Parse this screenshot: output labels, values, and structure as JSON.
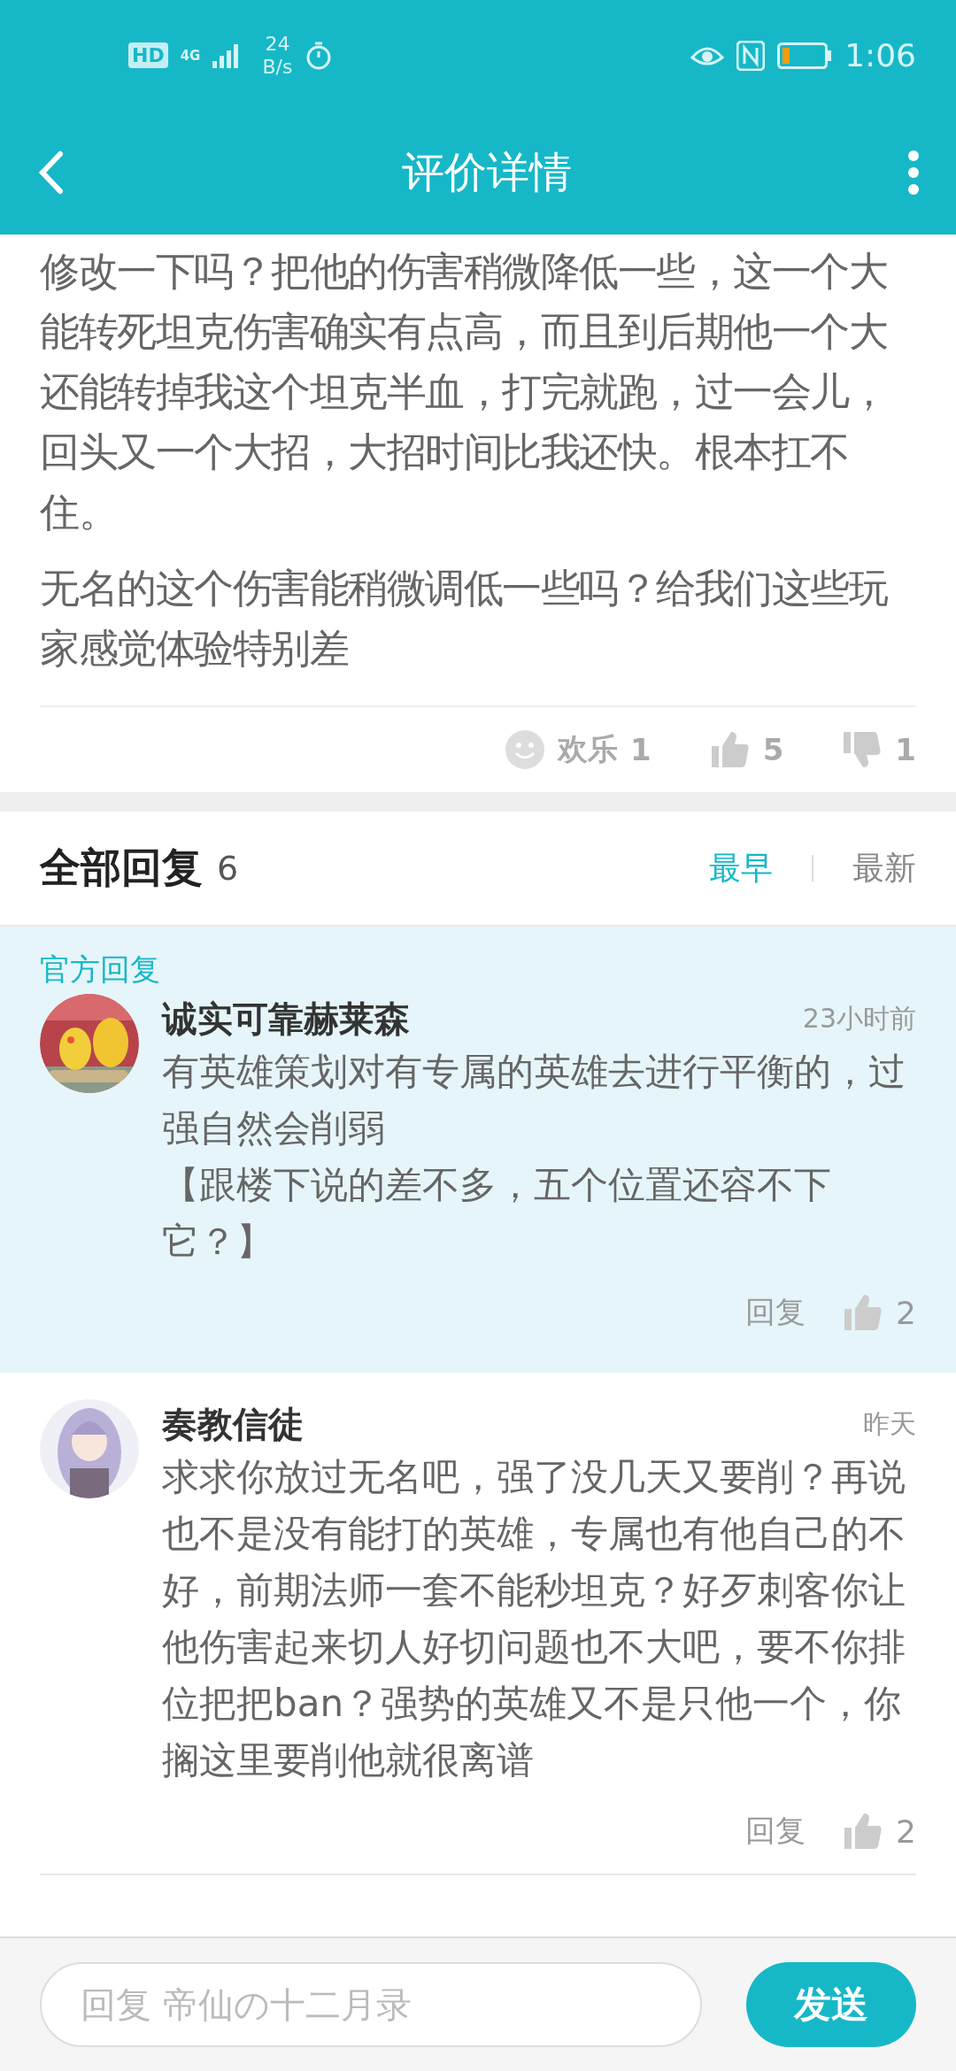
{
  "status_bar": {
    "hd": "HD",
    "network": "4G",
    "speed_value": "24",
    "speed_unit": "B/s",
    "time": "1:06"
  },
  "header": {
    "title": "评价详情"
  },
  "review": {
    "paragraphs": [
      "修改一下吗？把他的伤害稍微降低一些，这一个大能转死坦克伤害确实有点高，而且到后期他一个大还能转掉我这个坦克半血，打完就跑，过一会儿，回头又一个大招，大招时间比我还快。根本扛不住。",
      "无名的这个伤害能稍微调低一些吗？给我们这些玩家感觉体验特别差"
    ],
    "reactions": [
      {
        "kind": "emoji",
        "label": "欢乐",
        "count": "1"
      },
      {
        "kind": "like",
        "count": "5"
      },
      {
        "kind": "dislike",
        "count": "1"
      }
    ]
  },
  "replies": {
    "title": "全部回复",
    "count": "6",
    "sort": [
      {
        "label": "最早",
        "selected": true
      },
      {
        "label": "最新",
        "selected": false
      }
    ],
    "items": [
      {
        "official": true,
        "official_label": "官方回复",
        "name": "诚实可靠赫莱森",
        "time": "23小时前",
        "paragraphs": [
          "有英雄策划对有专属的英雄去进行平衡的，过强自然会削弱",
          "【跟楼下说的差不多，五个位置还容不下它？】"
        ],
        "reply_label": "回复",
        "likes": "2"
      },
      {
        "official": false,
        "name": "奏教信徒",
        "time": "昨天",
        "paragraphs": [
          "求求你放过无名吧，强了没几天又要削？再说也不是没有能打的英雄，专属也有他自己的不好，前期法师一套不能秒坦克？好歹刺客你让他伤害起来切人好切问题也不大吧，要不你排位把把ban？强势的英雄又不是只他一个，你搁这里要削他就很离谱"
        ],
        "reply_label": "回复",
        "likes": "2"
      }
    ]
  },
  "reply_bar": {
    "placeholder": "回复 帝仙の十二月录",
    "send": "发送"
  }
}
